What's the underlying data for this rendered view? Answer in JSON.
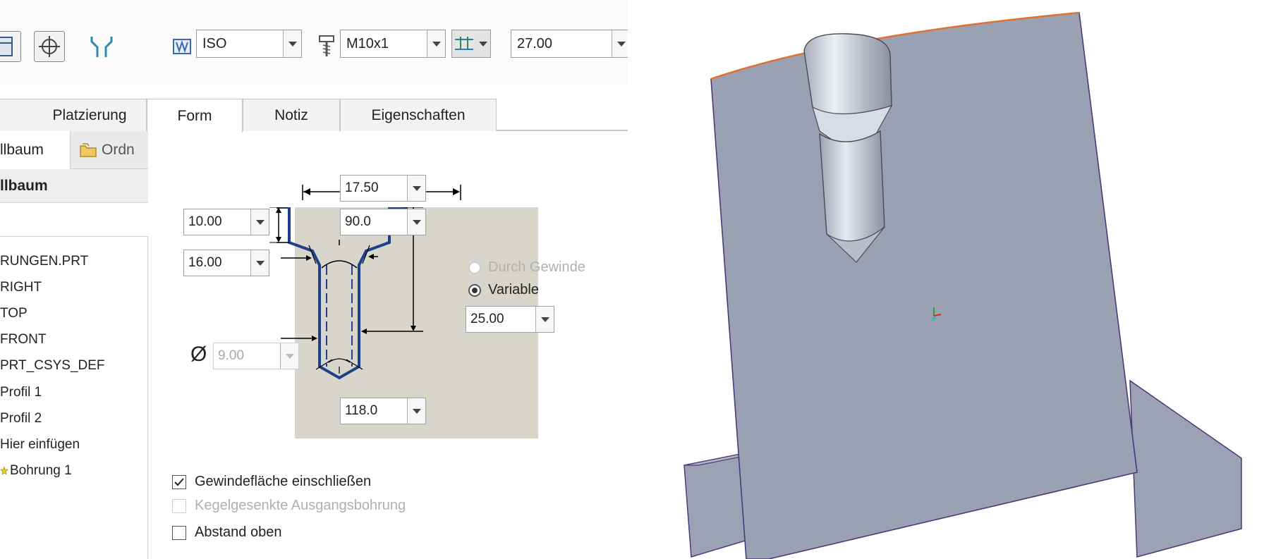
{
  "ribbon": {
    "standard_value": "ISO",
    "thread_value": "M10x1",
    "depth_value": "27.00"
  },
  "tabs": [
    {
      "label": "Platzierung"
    },
    {
      "label": "Form"
    },
    {
      "label": "Notiz"
    },
    {
      "label": "Eigenschaften"
    }
  ],
  "tree": {
    "tab_model": "llbaum",
    "tab_layers": "Ordn",
    "header": "llbaum",
    "items": [
      {
        "label": "RUNGEN.PRT"
      },
      {
        "label": "RIGHT"
      },
      {
        "label": "TOP"
      },
      {
        "label": "FRONT"
      },
      {
        "label": "PRT_CSYS_DEF"
      },
      {
        "label": "Profil 1"
      },
      {
        "label": "Profil 2"
      },
      {
        "label": "Hier einfügen"
      },
      {
        "label": "Bohrung 1"
      }
    ]
  },
  "form": {
    "counterbore_diameter": "17.50",
    "counterbore_depth": "10.00",
    "countersink_angle": "90.0",
    "countersink_depth": "16.00",
    "hole_diameter_symbol": "Ø",
    "hole_diameter": "9.00",
    "drill_tip_angle": "118.0",
    "radio_thru_thread": "Durch Gewinde",
    "radio_variable": "Variable",
    "thread_depth": "25.00",
    "check_thread_surface": "Gewindefläche einschließen",
    "check_thread_surface_checked": true,
    "check_countersunk_exit": "Kegelgesenkte Ausgangsbohrung",
    "check_countersunk_exit_checked": false,
    "check_top_clearance": "Abstand oben",
    "check_top_clearance_checked": false
  },
  "colors": {
    "profile_line": "#1f3e8c",
    "diagram_bg": "#d8d5cb",
    "model_face": "#9aa2b4",
    "model_edge": "#4a3a78",
    "model_highlight": "#e07030"
  }
}
